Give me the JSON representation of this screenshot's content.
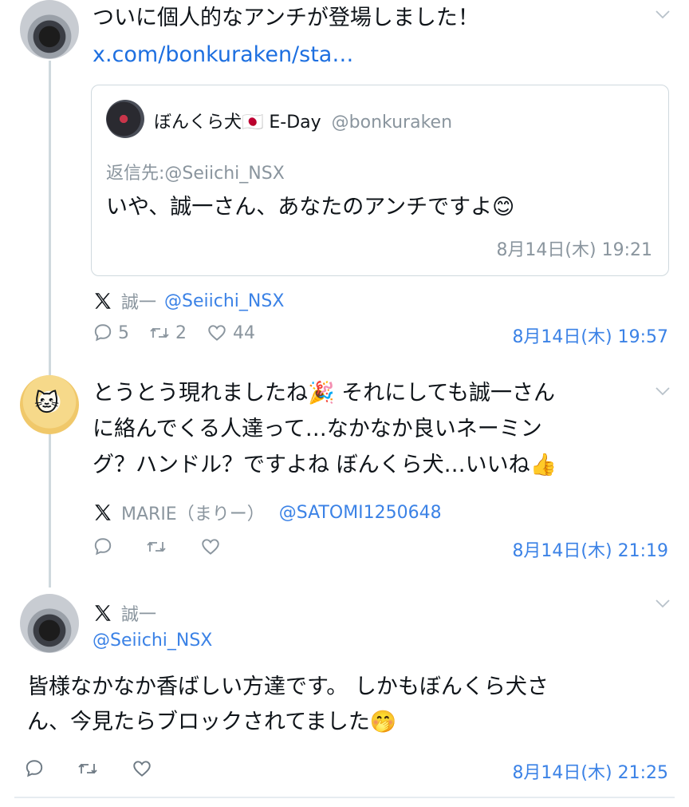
{
  "tweet1": {
    "text": "ついに個人的なアンチが登場しました！",
    "link": "x.com/bonkuraken/sta…",
    "quote": {
      "display_name": "ぼんくら犬🇯🇵 E-Day",
      "handle": "@bonkuraken",
      "reply_to": "返信先:@Seiichi_NSX",
      "text": "いや、誠一さん、あなたのアンチですよ😊",
      "time": "8月14日(木) 19:21"
    },
    "source_name": "誠一",
    "source_handle": "@Seiichi_NSX",
    "replies": "5",
    "retweets": "2",
    "likes": "44",
    "time": "8月14日(木) 19:57"
  },
  "tweet2": {
    "lines": [
      "とうとう現れましたね🎉 それにしても誠一さん",
      "に絡んでくる人達って…なかなか良いネーミン",
      "グ？ハンドル？ですよね ぼんくら犬…いいね👍"
    ],
    "source_name": "MARIE（まりー）",
    "source_handle": "@SATOMI1250648",
    "time": "8月14日(木) 21:19"
  },
  "tweet3": {
    "name": "誠一",
    "handle": "@Seiichi_NSX",
    "lines": [
      "皆様なかなか香ばしい方達です。 しかもぼんくら犬さ",
      "ん、今見たらブロックされてました🤭"
    ],
    "time": "8月14日(木) 21:25"
  },
  "icons": {
    "reply": "speech-bubble-icon",
    "retweet": "retweet-icon",
    "like": "heart-icon",
    "x": "x-logo-icon",
    "menu": "chevron-down-icon"
  },
  "colors": {
    "link": "#1d6fe0",
    "timestamp": "#3b82e6",
    "muted": "#8a959e",
    "border": "#cfd9de"
  }
}
